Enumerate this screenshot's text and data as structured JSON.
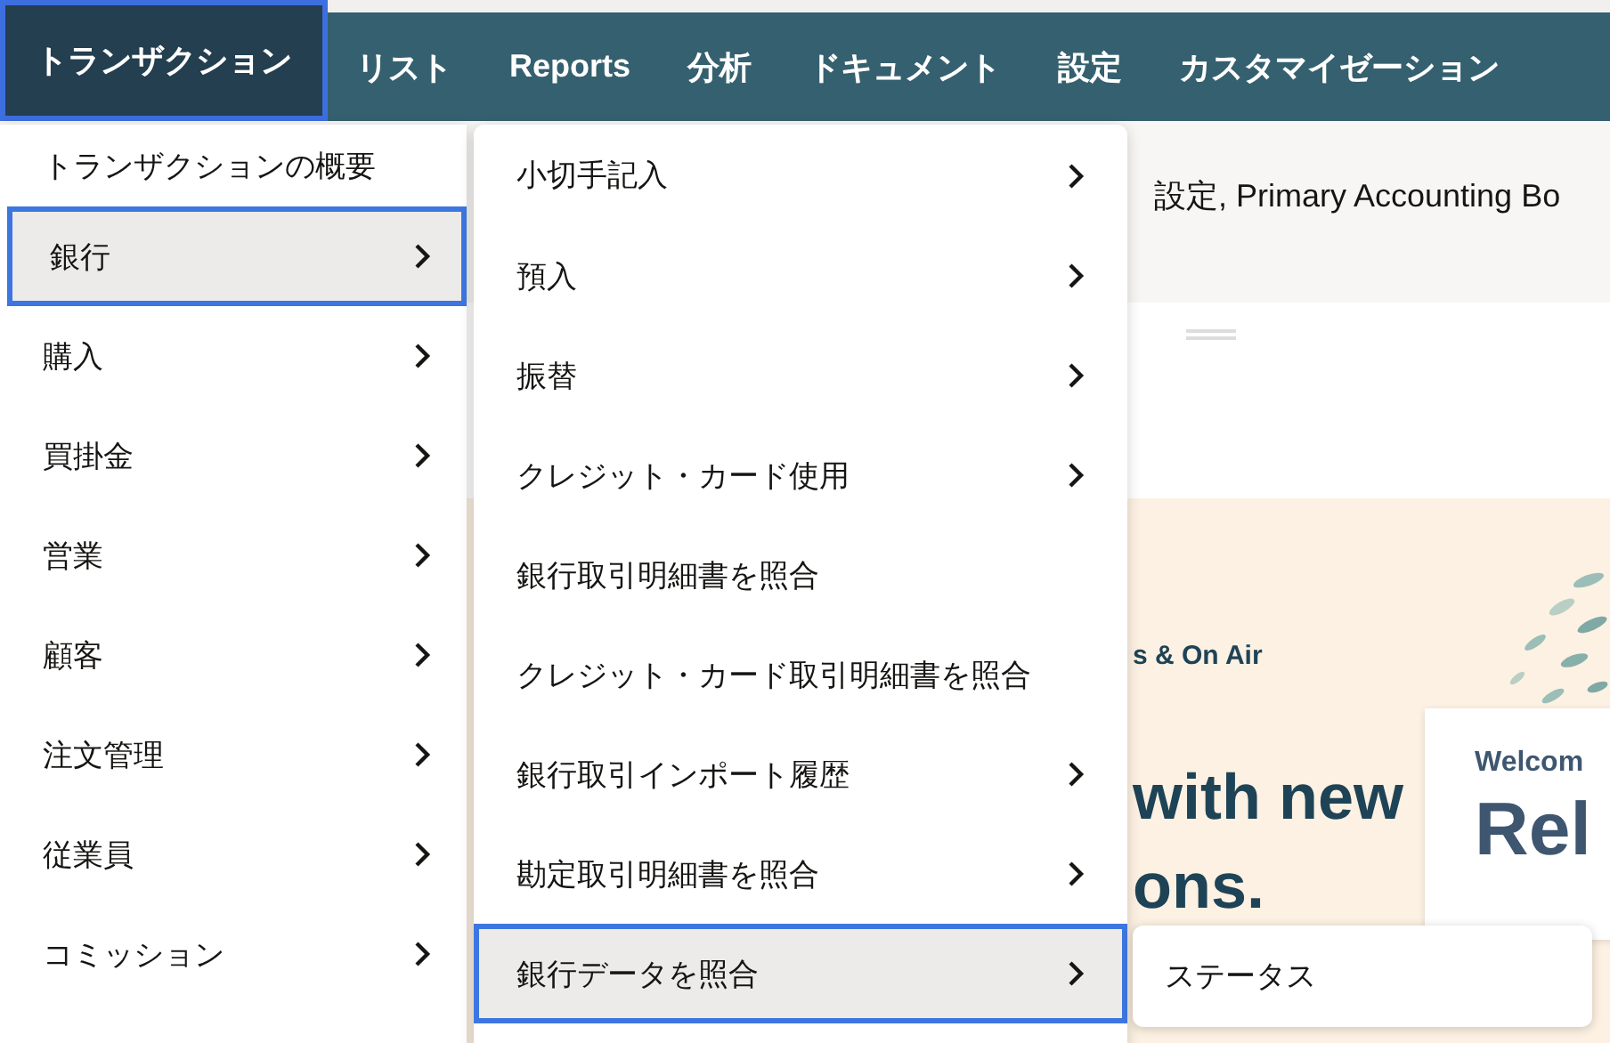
{
  "nav": {
    "items": [
      {
        "label": "トランザクション",
        "selected": true
      },
      {
        "label": "リスト",
        "selected": false
      },
      {
        "label": "Reports",
        "selected": false
      },
      {
        "label": "分析",
        "selected": false
      },
      {
        "label": "ドキュメント",
        "selected": false
      },
      {
        "label": "設定",
        "selected": false
      },
      {
        "label": "カスタマイゼーション",
        "selected": false
      }
    ]
  },
  "page": {
    "header_text": "設定, Primary Accounting Bo",
    "banner": {
      "eyebrow": "s & On Air",
      "headline": [
        "with new",
        "ons."
      ]
    },
    "welcome_card": {
      "label": "Welcom",
      "title": "Rel"
    }
  },
  "menu": {
    "items": [
      {
        "label": "トランザクションの概要",
        "has_submenu": false,
        "selected": false
      },
      {
        "label": "銀行",
        "has_submenu": true,
        "selected": true
      },
      {
        "label": "購入",
        "has_submenu": true,
        "selected": false
      },
      {
        "label": "買掛金",
        "has_submenu": true,
        "selected": false
      },
      {
        "label": "営業",
        "has_submenu": true,
        "selected": false
      },
      {
        "label": "顧客",
        "has_submenu": true,
        "selected": false
      },
      {
        "label": "注文管理",
        "has_submenu": true,
        "selected": false
      },
      {
        "label": "従業員",
        "has_submenu": true,
        "selected": false
      },
      {
        "label": "コミッション",
        "has_submenu": true,
        "selected": false
      }
    ]
  },
  "submenu": {
    "items": [
      {
        "label": "小切手記入",
        "has_submenu": true,
        "selected": false
      },
      {
        "label": "預入",
        "has_submenu": true,
        "selected": false
      },
      {
        "label": "振替",
        "has_submenu": true,
        "selected": false
      },
      {
        "label": "クレジット・カード使用",
        "has_submenu": true,
        "selected": false
      },
      {
        "label": "銀行取引明細書を照合",
        "has_submenu": false,
        "selected": false
      },
      {
        "label": "クレジット・カード取引明細書を照合",
        "has_submenu": false,
        "selected": false
      },
      {
        "label": "銀行取引インポート履歴",
        "has_submenu": true,
        "selected": false
      },
      {
        "label": "勘定取引明細書を照合",
        "has_submenu": true,
        "selected": false
      },
      {
        "label": "銀行データを照合",
        "has_submenu": true,
        "selected": true
      }
    ]
  },
  "flyout": {
    "items": [
      {
        "label": "ステータス"
      }
    ]
  }
}
